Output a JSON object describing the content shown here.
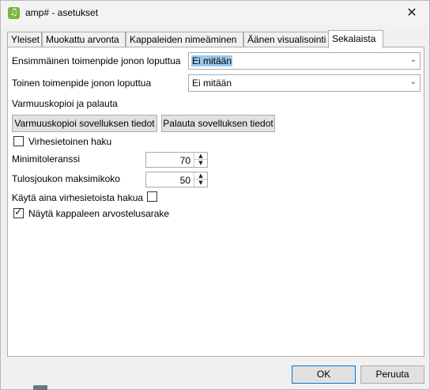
{
  "window": {
    "title": "amp# - asetukset",
    "close_glyph": "✕",
    "icon": "music-note-icon"
  },
  "tabs": [
    {
      "label": "Yleiset",
      "active": false
    },
    {
      "label": "Muokattu arvonta",
      "active": false
    },
    {
      "label": "Kappaleiden nimeäminen",
      "active": false
    },
    {
      "label": "Äänen visualisointi",
      "active": false
    },
    {
      "label": "Sekalaista",
      "active": true
    }
  ],
  "queue_end": {
    "first_label": "Ensimmäinen toimenpide jonon loputtua",
    "first_value": "Ei mitään",
    "second_label": "Toinen toimenpide jonon loputtua",
    "second_value": "Ei mitään"
  },
  "backup": {
    "section_label": "Varmuuskopioi ja palauta",
    "backup_button": "Varmuuskopioi sovelluksen tiedot",
    "restore_button": "Palauta sovelluksen tiedot"
  },
  "fuzzy": {
    "fuzzy_search_label": "Virhesietoinen haku",
    "fuzzy_search_checked": false,
    "min_tolerance_label": "Minimitoleranssi",
    "min_tolerance_value": "70",
    "max_results_label": "Tulosjoukon maksimikoko",
    "max_results_value": "50",
    "always_fuzzy_label": "Käytä aina virhesietoista hakua",
    "always_fuzzy_checked": false
  },
  "rating": {
    "show_rating_label": "Näytä kappaleen arvostelusarake",
    "show_rating_checked": true
  },
  "footer": {
    "ok_label": "OK",
    "cancel_label": "Peruuta"
  }
}
